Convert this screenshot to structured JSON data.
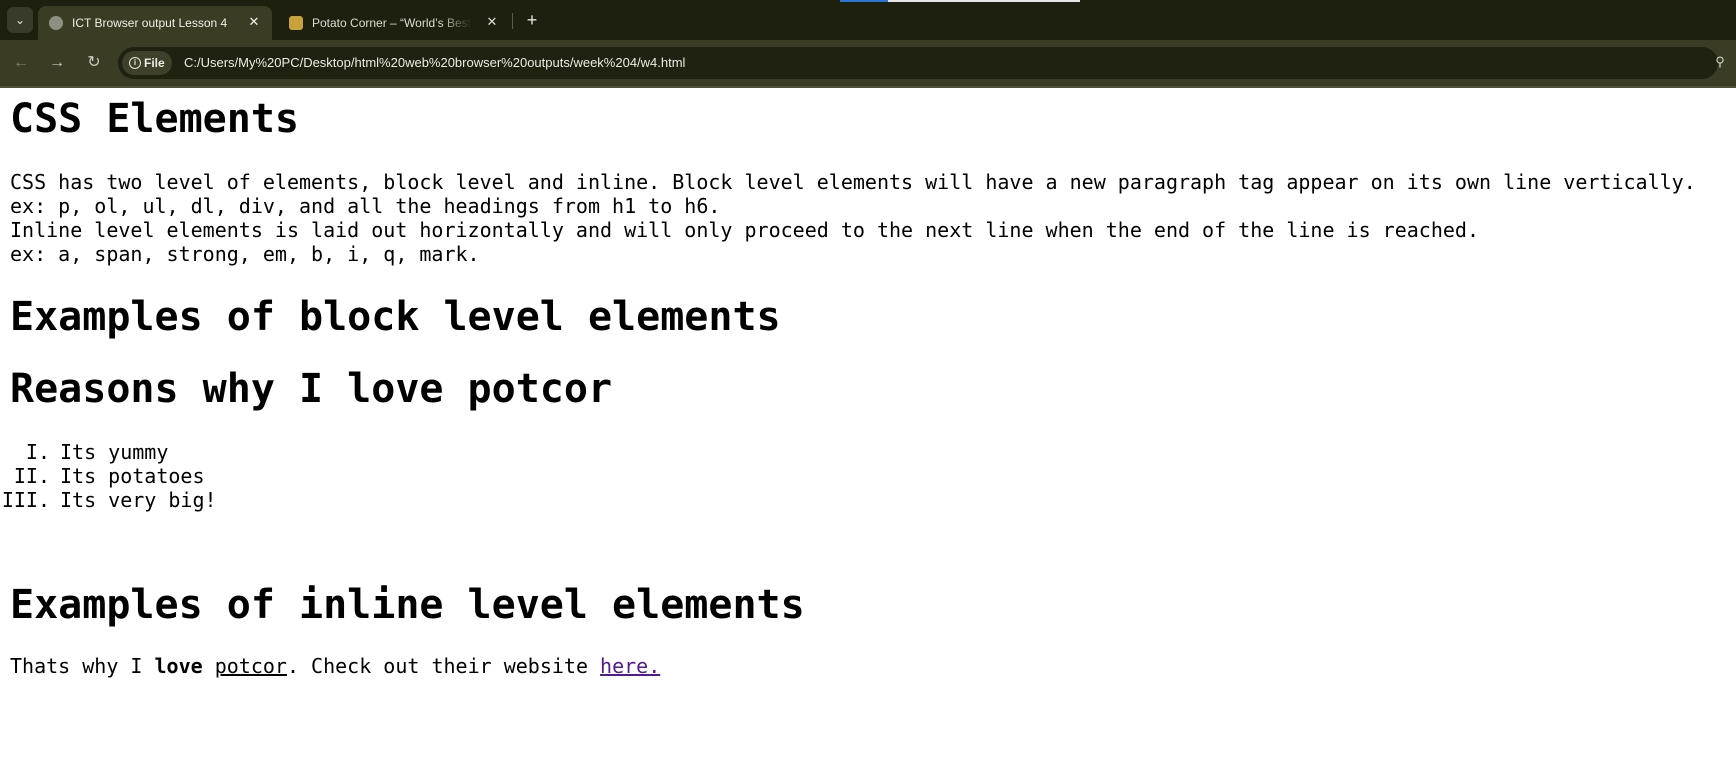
{
  "browser": {
    "tabs": [
      {
        "title": "ICT Browser output Lesson 4",
        "active": true
      },
      {
        "title": "Potato Corner – “World’s Best F",
        "active": false
      }
    ],
    "new_tab_symbol": "+",
    "site_chip_label": "File",
    "url": "C:/Users/My%20PC/Desktop/html%20web%20browser%20outputs/week%204/w4.html",
    "icons": {
      "tab_menu": "chevron-down-icon",
      "close": "close-icon",
      "back": "back-arrow-icon",
      "forward": "forward-arrow-icon",
      "reload": "reload-icon",
      "info": "info-icon",
      "zoom": "zoom-icon"
    },
    "colors": {
      "tabstrip": "#1e200f",
      "toolbar": "#3a3c24",
      "link_visited": "#551a8b"
    }
  },
  "page": {
    "heading_main": "CSS Elements",
    "intro_lines": [
      "CSS has two level of elements, block level and inline. Block level elements will have a new paragraph tag appear on its own line vertically.",
      "ex: p, ol, ul, dl, div, and all the headings from h1 to h6.",
      "Inline level elements is laid out horizontally and will only proceed to the next line when the end of the line is reached.",
      "ex: a, span, strong, em, b, i, q, mark."
    ],
    "heading_block": "Examples of block level elements",
    "heading_reasons": "Reasons why I love potcor",
    "reasons": [
      {
        "num": "I.",
        "text": "Its yummy"
      },
      {
        "num": "II.",
        "text": "Its potatoes"
      },
      {
        "num": "III.",
        "text": "Its very big!"
      }
    ],
    "heading_inline": "Examples of inline level elements",
    "final": {
      "part1": "Thats why I ",
      "bold": "love",
      "space": " ",
      "underlined": "potcor",
      "part2": ". Check out their website ",
      "link": "here."
    }
  }
}
